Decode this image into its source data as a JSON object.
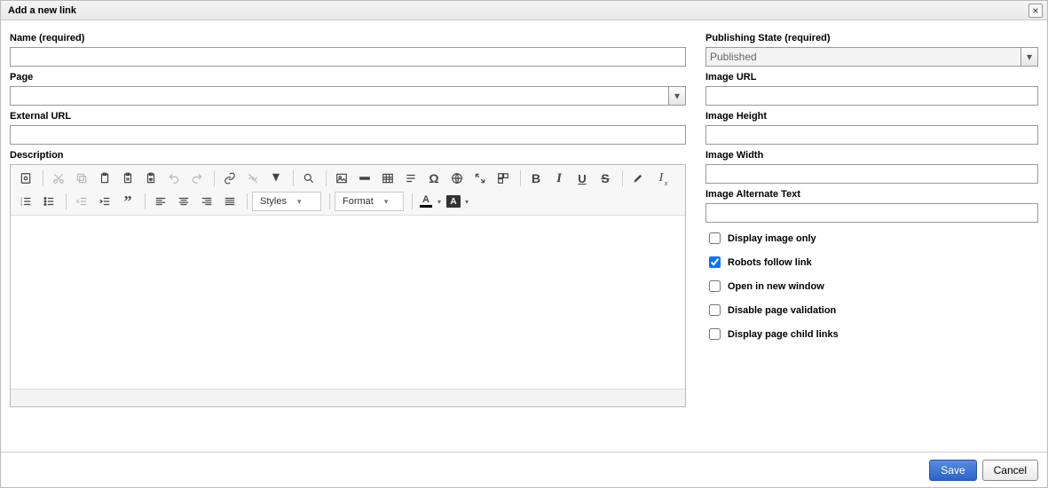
{
  "dialog": {
    "title": "Add a new link",
    "close_label": "×"
  },
  "left": {
    "name_label": "Name (required)",
    "name_value": "",
    "page_label": "Page",
    "page_value": "",
    "ext_url_label": "External URL",
    "ext_url_value": "",
    "description_label": "Description"
  },
  "right": {
    "pubstate_label": "Publishing State (required)",
    "pubstate_value": "Published",
    "image_url_label": "Image URL",
    "image_url_value": "",
    "image_height_label": "Image Height",
    "image_height_value": "",
    "image_width_label": "Image Width",
    "image_width_value": "",
    "image_alt_label": "Image Alternate Text",
    "image_alt_value": "",
    "chk_display_image_only": "Display image only",
    "chk_robots_follow": "Robots follow link",
    "chk_open_new_window": "Open in new window",
    "chk_disable_page_validation": "Disable page validation",
    "chk_display_child_links": "Display page child links"
  },
  "editor_toolbar": {
    "styles_label": "Styles",
    "format_label": "Format",
    "text_color_glyph": "A",
    "bg_color_glyph": "A"
  },
  "footer": {
    "save_label": "Save",
    "cancel_label": "Cancel"
  }
}
